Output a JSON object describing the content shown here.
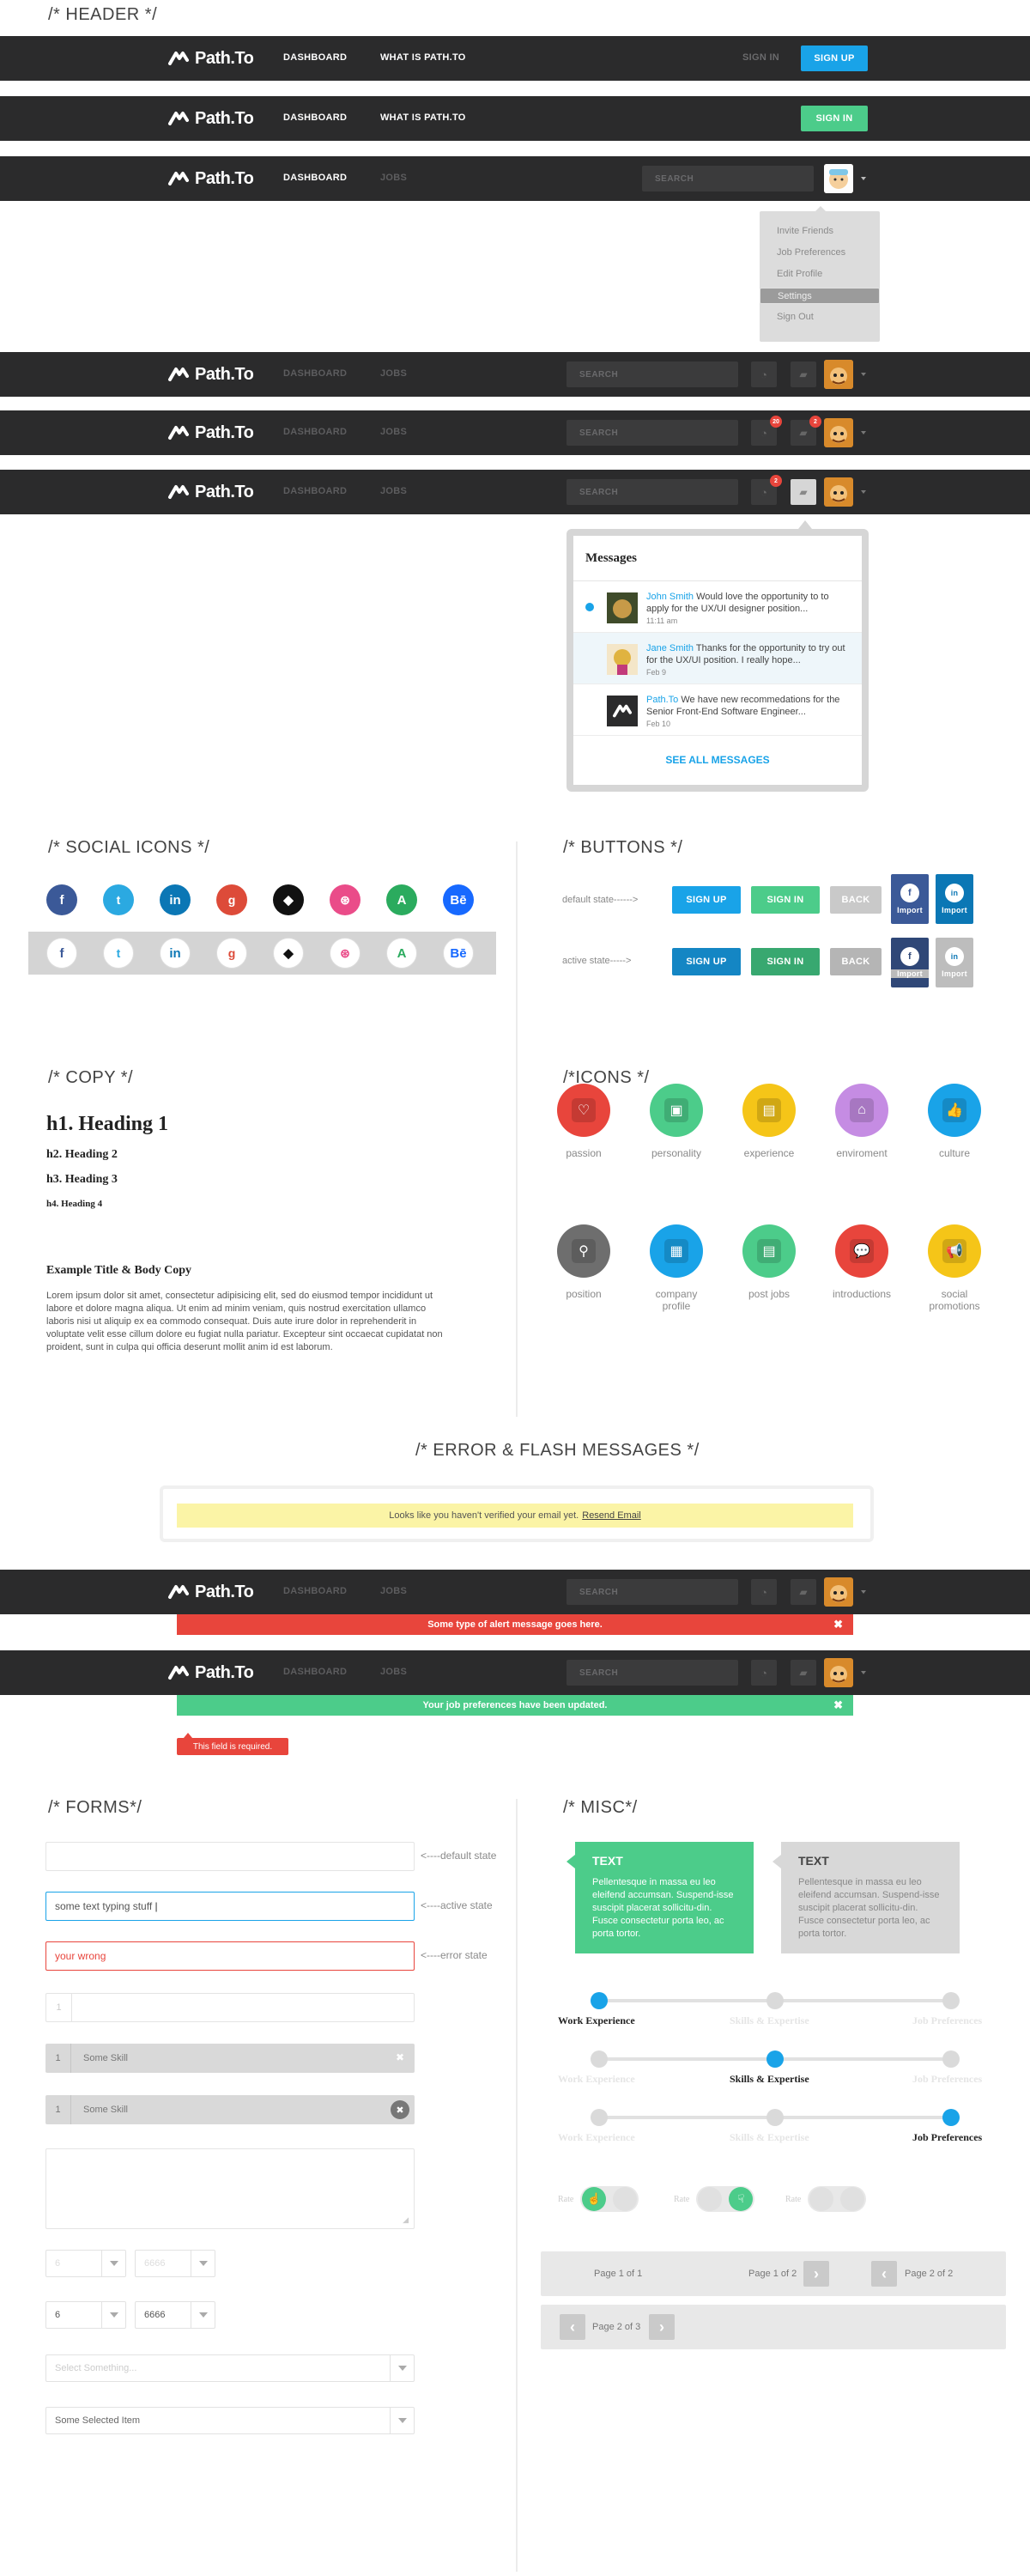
{
  "sections": {
    "header": "/* HEADER */",
    "social": "/* SOCIAL ICONS */",
    "buttons": "/* BUTTONS */",
    "copy": "/* COPY */",
    "icons": "/*ICONS */",
    "errors": "/* ERROR & FLASH MESSAGES */",
    "forms": "/* FORMS*/",
    "misc": "/* MISC*/"
  },
  "brand": {
    "name": "Path.To"
  },
  "nav": {
    "dashboard": "DASHBOARD",
    "what_is": "WHAT IS PATH.TO",
    "jobs": "JOBS",
    "sign_in": "SIGN IN",
    "sign_up": "SIGN UP",
    "search_placeholder": "SEARCH"
  },
  "badges": {
    "notif": "20",
    "msgs": "2",
    "notif2": "2"
  },
  "dropdown": [
    "Invite Friends",
    "Job Preferences",
    "Edit Profile",
    "Settings",
    "Sign Out"
  ],
  "messages": {
    "title": "Messages",
    "items": [
      {
        "name": "John Smith",
        "text": " Would love the opportunity to to apply for the UX/UI designer position...",
        "date": "11:11 am"
      },
      {
        "name": "Jane Smith",
        "text": " Thanks for the opportunity to try out for the UX/UI position. I really hope...",
        "date": "Feb 9"
      },
      {
        "name": "Path.To",
        "text": " We have new recommedations for the Senior Front-End Software Engineer...",
        "date": "Feb 10"
      }
    ],
    "see_all": "SEE ALL MESSAGES"
  },
  "social_icons": [
    "facebook-icon",
    "twitter-icon",
    "linkedin-icon",
    "google-plus-icon",
    "github-icon",
    "dribbble-icon",
    "angellist-icon",
    "behance-icon"
  ],
  "social_glyphs": [
    "f",
    "t",
    "in",
    "g",
    "◆",
    "⊛",
    "A",
    "Bē"
  ],
  "social_colors": [
    "#3b5998",
    "#2ba9e1",
    "#0b77b5",
    "#dd4b39",
    "#111111",
    "#ea4c89",
    "#2bab5e",
    "#1769ff"
  ],
  "buttons": {
    "default_label": "default state------>",
    "active_label": "active state----->",
    "sign_up": "SIGN UP",
    "sign_in": "SIGN IN",
    "back": "BACK",
    "import": "Import"
  },
  "copy": {
    "h1": "h1. Heading 1",
    "h2": "h2. Heading 2",
    "h3": "h3. Heading 3",
    "h4": "h4. Heading 4",
    "example_title": "Example Title & Body Copy",
    "body": "Lorem ipsum dolor sit amet, consectetur adipisicing elit, sed do eiusmod tempor incididunt ut labore et dolore magna aliqua. Ut enim ad minim veniam, quis nostrud exercitation ullamco laboris nisi ut aliquip ex ea commodo consequat. Duis aute irure dolor in reprehenderit in voluptate velit esse cillum dolore eu fugiat nulla pariatur. Excepteur sint occaecat cupidatat non proident, sunt in culpa qui officia deserunt mollit anim id est laborum."
  },
  "icons": [
    {
      "label": "passion",
      "color": "#e8453c",
      "glyph": "♡"
    },
    {
      "label": "personality",
      "color": "#4ccc8a",
      "glyph": "▣"
    },
    {
      "label": "experience",
      "color": "#f5c518",
      "glyph": "▤"
    },
    {
      "label": "enviroment",
      "color": "#c58ce3",
      "glyph": "⌂"
    },
    {
      "label": "culture",
      "color": "#19a3e8",
      "glyph": "👍"
    },
    {
      "label": "position",
      "color": "#6e6e6e",
      "glyph": "⚲"
    },
    {
      "label": "company\nprofile",
      "color": "#19a3e8",
      "glyph": "▦"
    },
    {
      "label": "post jobs",
      "color": "#4ccc8a",
      "glyph": "▤"
    },
    {
      "label": "introductions",
      "color": "#e8453c",
      "glyph": "💬"
    },
    {
      "label": "social\npromotions",
      "color": "#f5c518",
      "glyph": "📢"
    }
  ],
  "flash": {
    "verify": "Looks like you haven't verified your email yet.",
    "resend": "Resend Email",
    "alert": "Some type of alert message goes here.",
    "success": "Your job preferences have been updated.",
    "required": "This field is required.",
    "close": "✖"
  },
  "forms": {
    "default_note": "<----default state",
    "active_note": "<----active state",
    "error_note": "<----error state",
    "active_value": "some text typing stuff",
    "error_value": "your wrong",
    "num": "1",
    "skill": "Some Skill",
    "sel_a": "6",
    "sel_b": "6666",
    "select_placeholder": "Select Something...",
    "select_value": "Some Selected Item"
  },
  "misc": {
    "tip_title": "TEXT",
    "tip_body": "Pellentesque in massa eu leo eleifend accumsan. Suspend-isse suscipit placerat sollicitu-din. Fusce consectetur porta leo, ac porta tortor.",
    "steps": [
      "Work Experience",
      "Skills & Expertise",
      "Job Preferences"
    ],
    "rate": "Rate",
    "page1": "Page 1 of 1",
    "page2": "Page 1 of 2",
    "page3": "Page 2 of 2",
    "page4": "Page 2 of 3"
  }
}
